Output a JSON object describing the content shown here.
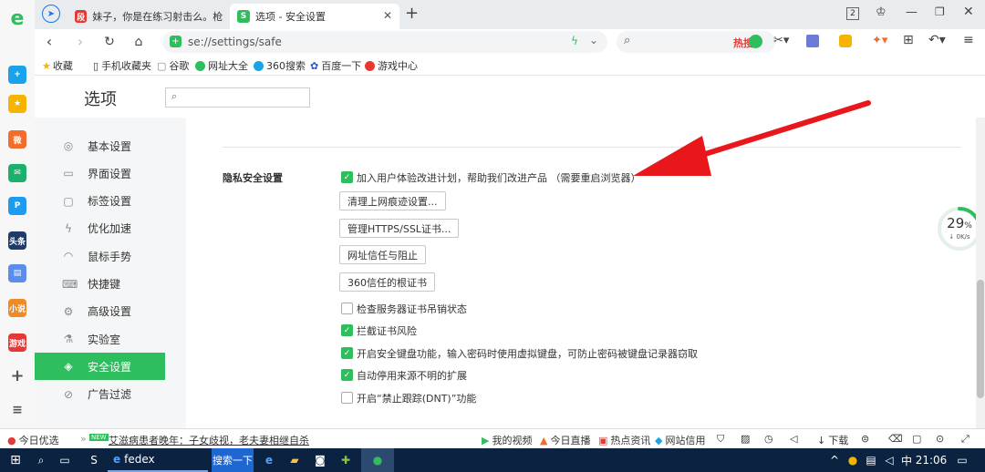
{
  "browser": {
    "tabs": [
      {
        "label": "妹子，你是在练习射击么。枪法",
        "favicon_text": "段",
        "active": false
      },
      {
        "label": "选项 - 安全设置",
        "favicon_text": "S",
        "active": true
      }
    ],
    "new_tab_label": "+",
    "window_badge": "2",
    "address": "se://settings/safe",
    "hot_label": "热搜"
  },
  "bookmarks": [
    {
      "label": "收藏",
      "icon": "star-icon"
    },
    {
      "label": "手机收藏夹",
      "icon": "phone-icon"
    },
    {
      "label": "谷歌",
      "icon": "page-icon"
    },
    {
      "label": "网址大全",
      "icon": "globe-icon"
    },
    {
      "label": "360搜索",
      "icon": "search-360-icon"
    },
    {
      "label": "百度一下",
      "icon": "baidu-icon"
    },
    {
      "label": "游戏中心",
      "icon": "game-icon"
    }
  ],
  "rail_icons": [
    {
      "name": "ie-logo",
      "text": "e",
      "color": "#2fbe5e"
    },
    {
      "name": "add-icon",
      "text": "+",
      "color": "#1aa3e8"
    },
    {
      "name": "favorites-icon",
      "text": "★",
      "color": "#f5b400"
    },
    {
      "name": "weibo-icon",
      "text": "微",
      "color": "#f26c2a"
    },
    {
      "name": "mail-icon",
      "text": "✉",
      "color": "#1bb06b"
    },
    {
      "name": "pdf-icon",
      "text": "P",
      "color": "#1d9bf0"
    },
    {
      "name": "news-icon",
      "text": "头条",
      "color": "#1f3b6b"
    },
    {
      "name": "doc-icon",
      "text": "▤",
      "color": "#5b8def"
    },
    {
      "name": "novel-icon",
      "text": "小说",
      "color": "#f08a24"
    },
    {
      "name": "game-icon",
      "text": "游戏",
      "color": "#e53935"
    }
  ],
  "settings": {
    "title": "选项",
    "search_placeholder": "",
    "nav": [
      {
        "label": "基本设置",
        "icon": "◎"
      },
      {
        "label": "界面设置",
        "icon": "▭"
      },
      {
        "label": "标签设置",
        "icon": "▢"
      },
      {
        "label": "优化加速",
        "icon": "ϟ"
      },
      {
        "label": "鼠标手势",
        "icon": "◠"
      },
      {
        "label": "快捷键",
        "icon": "⌨"
      },
      {
        "label": "高级设置",
        "icon": "⚙"
      },
      {
        "label": "实验室",
        "icon": "⚗"
      },
      {
        "label": "安全设置",
        "icon": "◈"
      },
      {
        "label": "广告过滤",
        "icon": "⊘"
      }
    ],
    "active_nav": "安全设置",
    "section_title": "隐私安全设置",
    "options": [
      {
        "label": "加入用户体验改进计划，帮助我们改进产品 （需要重启浏览器）",
        "checked": true
      },
      {
        "label": "检查服务器证书吊销状态",
        "checked": false
      },
      {
        "label": "拦截证书风险",
        "checked": true
      },
      {
        "label": "开启安全键盘功能，输入密码时使用虚拟键盘，可防止密码被键盘记录器窃取",
        "checked": true
      },
      {
        "label": "自动停用来源不明的扩展",
        "checked": true
      },
      {
        "label": "开启“禁止跟踪(DNT)”功能",
        "checked": false
      }
    ],
    "buttons": [
      "清理上网痕迹设置...",
      "管理HTTPS/SSL证书...",
      "网址信任与阻止",
      "360信任的根证书"
    ]
  },
  "speed_widget": {
    "percent": "29",
    "unit": "%",
    "rate": "0K/s",
    "fraction": 0.29
  },
  "statusbar": {
    "left": "今日优选",
    "news_badge": "NEW",
    "news": "艾滋病患者晚年：子女歧视，老夫妻相继自杀",
    "items": [
      "我的视频",
      "今日直播",
      "热点资讯",
      "网站信用"
    ],
    "download": "下载"
  },
  "taskbar": {
    "app_label": "fedex",
    "search_label": "搜索一下",
    "ime": "中",
    "time": "21:06"
  }
}
